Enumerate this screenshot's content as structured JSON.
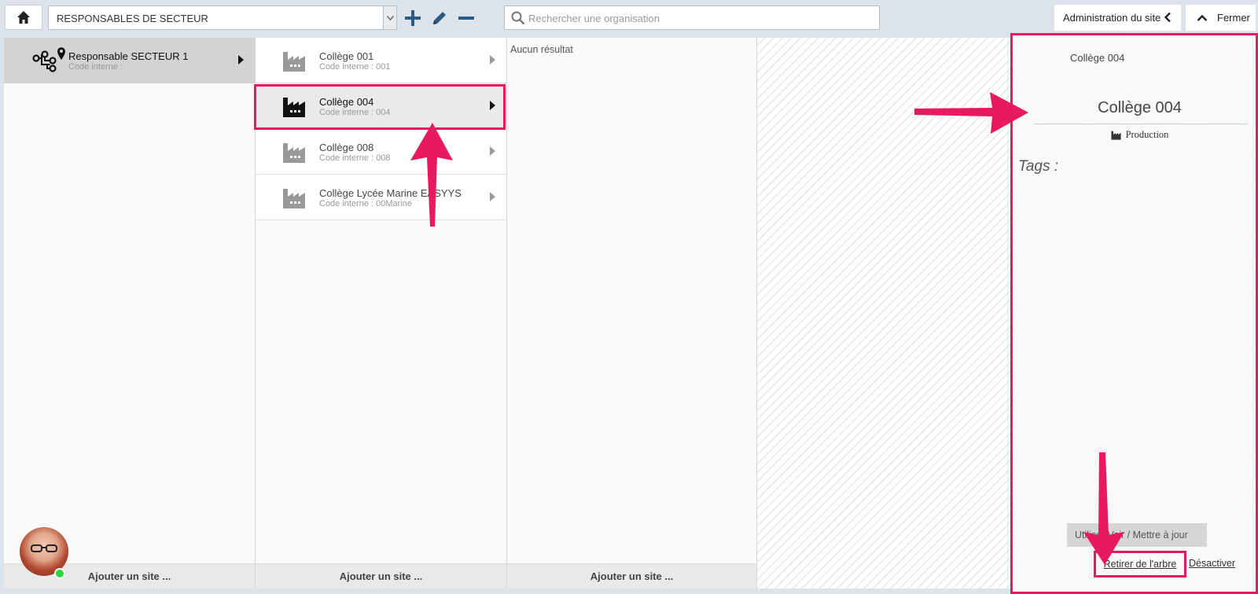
{
  "toolbar": {
    "tree_select_value": "RESPONSABLES DE SECTEUR",
    "search_placeholder": "Rechercher une organisation",
    "admin_label": "Administration du site",
    "close_label": "Fermer"
  },
  "sector_column": {
    "item": {
      "title": "Responsable SECTEUR 1",
      "subtitle": "Code interne :"
    },
    "footer": "Ajouter un site ..."
  },
  "org_column": {
    "items": [
      {
        "title": "Collège 001",
        "subtitle": "Code interne : 001"
      },
      {
        "title": "Collège 004",
        "subtitle": "Code interne : 004"
      },
      {
        "title": "Collège 008",
        "subtitle": "Code interne : 008"
      },
      {
        "title": "Collège Lycée Marine EASYYS",
        "subtitle": "Code interne : 00Marine"
      }
    ],
    "footer": "Ajouter un site ..."
  },
  "third_column": {
    "no_result": "Aucun résultat",
    "footer": "Ajouter un site ..."
  },
  "detail": {
    "header": "Collège 004",
    "title": "Collège 004",
    "type": "Production",
    "tags_label": "Tags :",
    "update_button": "Utiliser   Voir / Mettre à jour",
    "remove_link": "Retirer de l'arbre",
    "deactivate_link": "Désactiver"
  },
  "colors": {
    "annotation": "#e8195f",
    "toolbar_icon": "#2c5a82",
    "online_status": "#2bd93a"
  },
  "icons": [
    "home-icon",
    "plus-icon",
    "pencil-icon",
    "minus-icon",
    "search-icon",
    "chevron-left-icon",
    "chevron-up-icon",
    "hierarchy-icon",
    "map-pin-icon",
    "factory-icon"
  ]
}
